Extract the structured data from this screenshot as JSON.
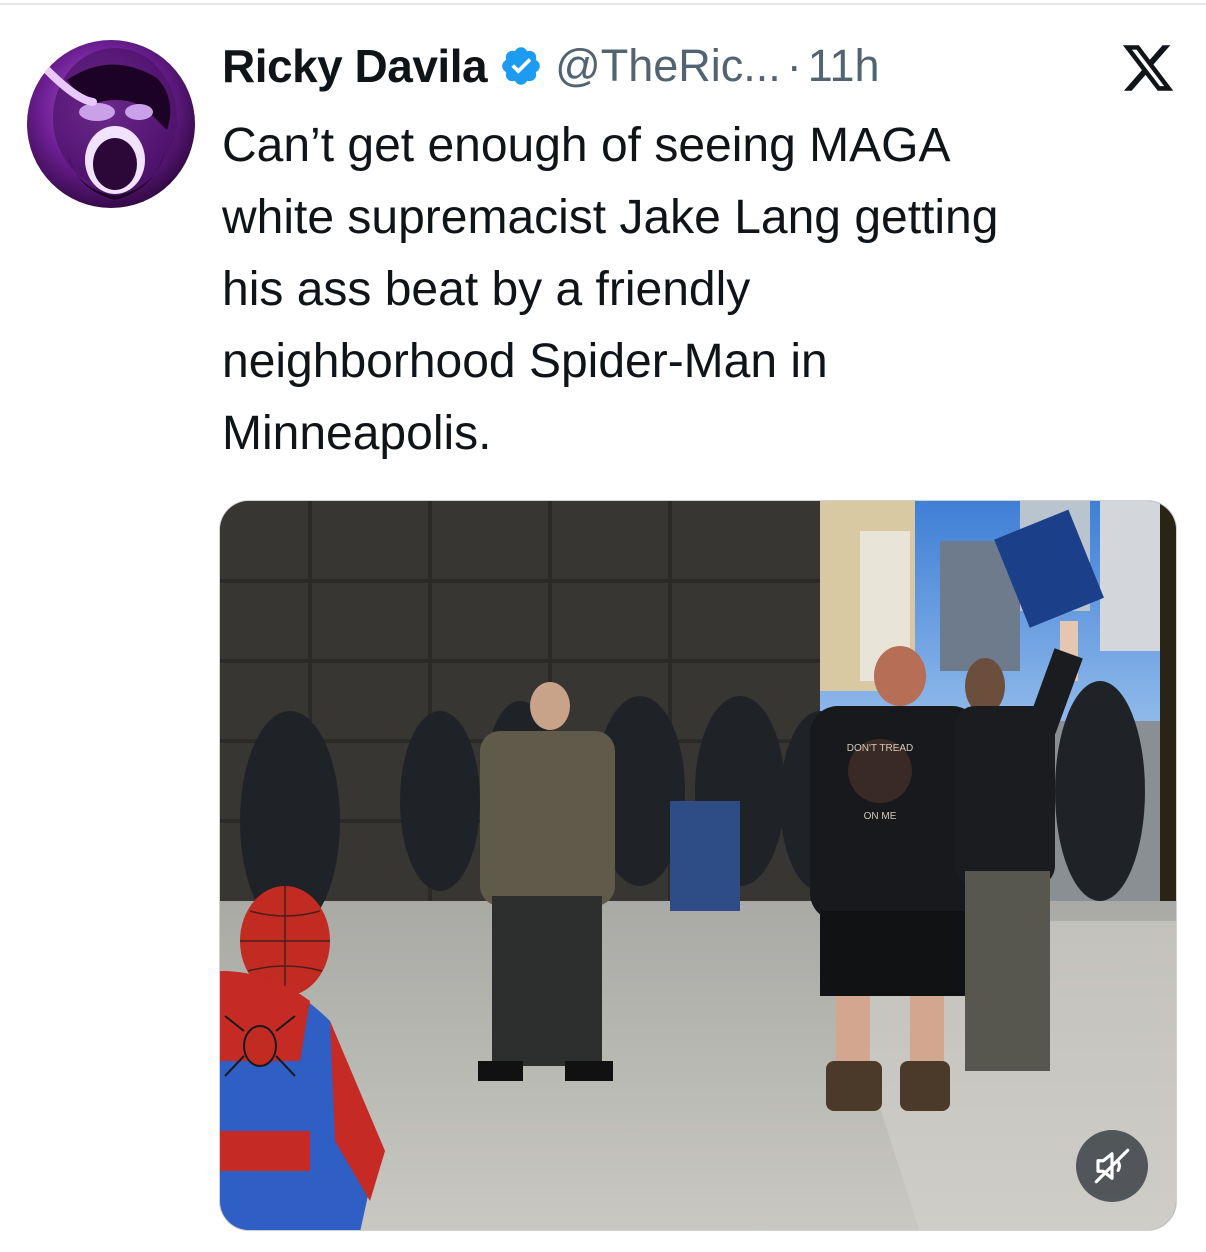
{
  "tweet": {
    "author": {
      "display_name": "Ricky Davila",
      "handle": "@TheRic...",
      "verified": true,
      "avatar_icon": "avatar-photo"
    },
    "separator": "·",
    "time": "11h",
    "platform_logo": "x-logo-icon",
    "text_lines": [
      "Can’t get enough of seeing MAGA",
      "white supremacist Jake Lang getting",
      "his ass beat by a friendly",
      "neighborhood Spider-Man in",
      "Minneapolis."
    ],
    "media": {
      "type": "video",
      "mute_icon": "speaker-muted-icon",
      "shirt_text_top": "DON'T TREAD",
      "shirt_text_bottom": "ON ME"
    }
  },
  "colors": {
    "text_primary": "#0f1419",
    "text_secondary": "#536471",
    "verified_blue": "#1d9bf0",
    "background": "#ffffff"
  }
}
